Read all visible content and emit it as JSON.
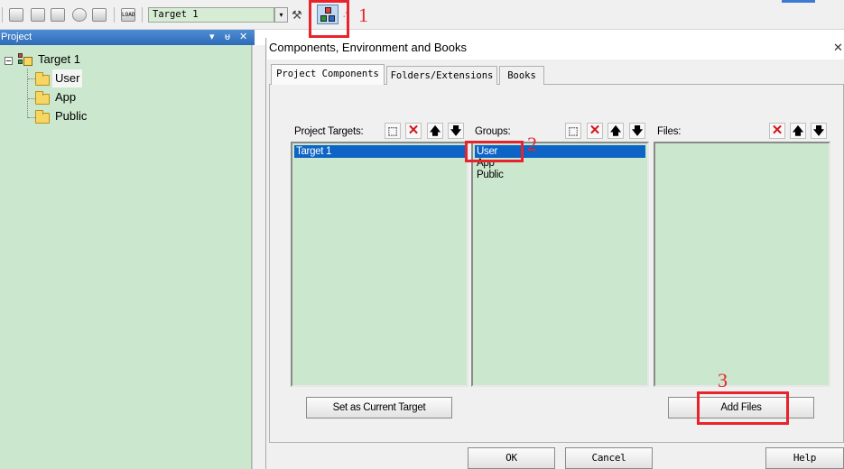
{
  "toolbar": {
    "target_select": "Target 1",
    "combo_arrow": "▾",
    "icons": [
      "batch-build-icon",
      "load-icon",
      "options-icon",
      "components-icon"
    ],
    "annotation_1": "1"
  },
  "project_panel": {
    "title": "Project",
    "controls": {
      "dropdown": "▾",
      "pin": "ᵾ",
      "close": "✕"
    },
    "tree": {
      "root": "Target 1",
      "expander": "⊟",
      "groups": [
        "User",
        "App",
        "Public"
      ]
    }
  },
  "dialog": {
    "title": "Components, Environment and Books",
    "close": "✕",
    "tabs": [
      "Project Components",
      "Folders/Extensions",
      "Books"
    ],
    "targets": {
      "label": "Project Targets:",
      "items": [
        "Target 1"
      ],
      "selected": "Target 1"
    },
    "groups": {
      "label": "Groups:",
      "items": [
        "User",
        "App",
        "Public"
      ],
      "selected": "User"
    },
    "files": {
      "label": "Files:",
      "items": []
    },
    "buttons": {
      "set_current_target": "Set as Current Target",
      "add_files": "Add Files",
      "ok": "OK",
      "cancel": "Cancel",
      "help": "Help"
    },
    "icons": {
      "new": "⬚",
      "delete": "✕",
      "up": "🡅",
      "down": "🡇"
    },
    "annotation_2": "2",
    "annotation_3": "3"
  },
  "colors": {
    "accent": "#e8232b",
    "selection": "#0e64c6",
    "list_bg": "#cbe7cd",
    "panel_header": "#3a7bc6"
  }
}
